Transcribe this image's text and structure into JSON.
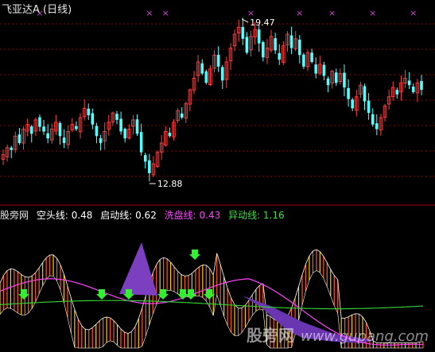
{
  "chart_title": "飞亚达A (日线)",
  "indicator": {
    "logo": "股旁网",
    "items": [
      {
        "label": "空头线: 0.48",
        "color": "#ffffff"
      },
      {
        "label": "启动线: 0.62",
        "color": "#ffffff"
      },
      {
        "label": "洗盘线: 0.43",
        "color": "#ff44ff"
      },
      {
        "label": "异动线: 1.16",
        "color": "#44dd44"
      }
    ]
  },
  "watermark": {
    "cn": "股旁网",
    "url": "www.gupang.com"
  },
  "colors": {
    "up": "#ff4040",
    "down": "#55ffff",
    "grid": "#8b0000",
    "purple_area": "#7b3fbf",
    "pink_line": "#ff44ff",
    "green_line": "#33cc33",
    "marker": "#cc44cc"
  },
  "chart_data": [
    {
      "type": "candlestick",
      "title": "飞亚达A (日线)",
      "annotations": [
        {
          "text": "19.47"
        },
        {
          "text": "12.88"
        }
      ],
      "marker_label": "×",
      "markers_at_index": [
        9,
        36,
        40,
        61,
        73,
        81,
        91,
        101,
        132
      ],
      "ylim": [
        11.9,
        20.2
      ],
      "closes": [
        13.8,
        14.1,
        14.0,
        14.6,
        14.3,
        14.9,
        15.1,
        14.7,
        15.3,
        15.0,
        14.8,
        14.5,
        14.9,
        15.2,
        14.6,
        14.3,
        14.8,
        15.1,
        14.9,
        15.4,
        15.8,
        15.5,
        15.1,
        14.6,
        14.3,
        14.8,
        15.2,
        15.6,
        15.3,
        14.8,
        14.5,
        14.9,
        15.3,
        14.7,
        13.9,
        13.5,
        13.0,
        13.4,
        13.9,
        14.3,
        14.8,
        14.6,
        15.2,
        15.7,
        15.4,
        16.0,
        16.6,
        17.1,
        17.8,
        17.3,
        16.9,
        17.5,
        18.1,
        17.6,
        17.0,
        17.8,
        18.4,
        19.0,
        19.3,
        18.8,
        18.2,
        18.9,
        19.2,
        18.6,
        18.0,
        18.4,
        18.9,
        18.3,
        17.9,
        18.5,
        19.0,
        18.4,
        18.8,
        18.1,
        17.6,
        18.2,
        17.8,
        17.3,
        17.7,
        17.2,
        16.8,
        17.4,
        16.9,
        17.3,
        16.7,
        16.2,
        15.8,
        16.3,
        16.8,
        16.1,
        15.6,
        15.1,
        14.9,
        15.4,
        15.9,
        16.3,
        16.7,
        16.4,
        16.9,
        17.1,
        16.8,
        16.5,
        16.9,
        16.6
      ],
      "series": [
        {
          "name": "空头线",
          "value": 0.48
        },
        {
          "name": "启动线",
          "value": 0.62
        },
        {
          "name": "洗盘线",
          "value": 0.43
        },
        {
          "name": "异动线",
          "value": 1.16
        }
      ]
    }
  ]
}
